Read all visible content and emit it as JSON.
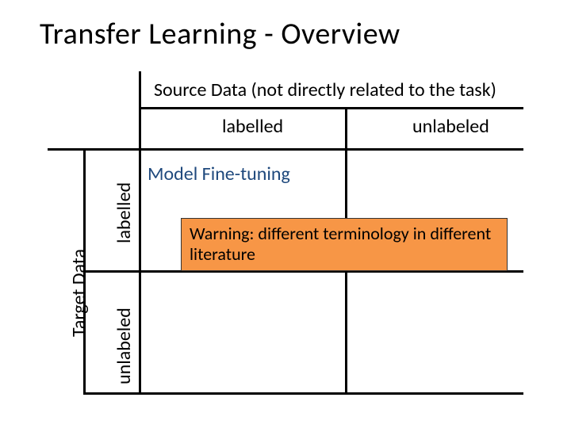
{
  "title": "Transfer Learning - Overview",
  "source_header": "Source Data (not directly related to the task)",
  "columns": {
    "labelled": "labelled",
    "unlabeled": "unlabeled"
  },
  "target_axis": "Target Data",
  "rows": {
    "labelled": "labelled",
    "unlabeled": "unlabeled"
  },
  "cells": {
    "source_labelled_target_labelled": "Model Fine-tuning"
  },
  "callout": "Warning: different terminology in different literature"
}
